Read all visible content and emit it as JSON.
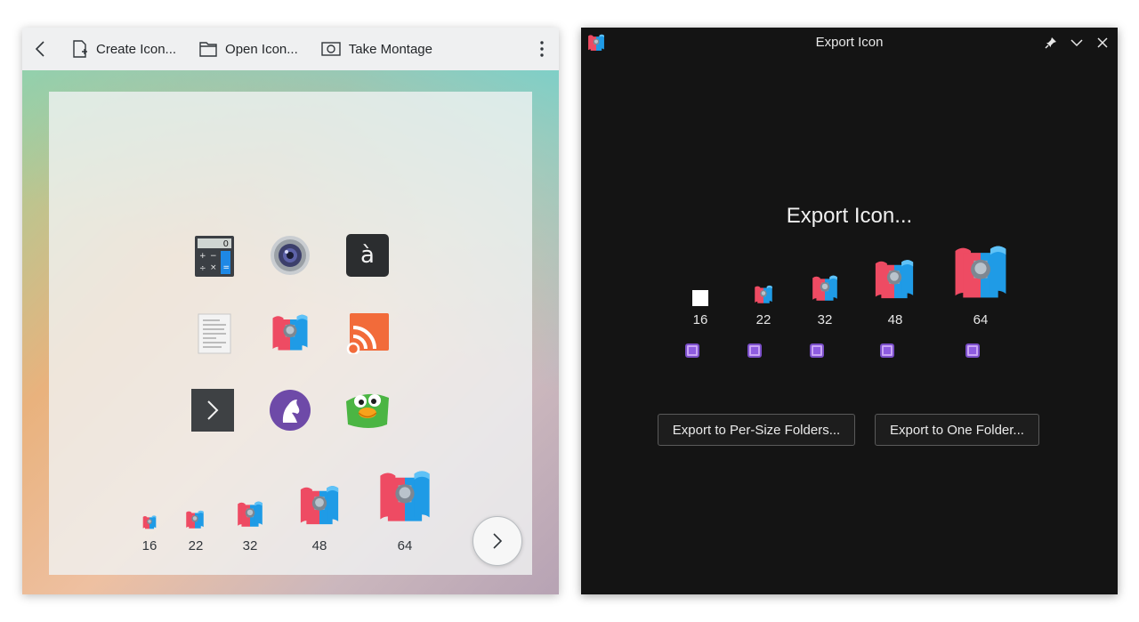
{
  "left_window": {
    "toolbar": {
      "back_icon": "chevron-left-icon",
      "create_icon": "Create Icon...",
      "open_icon": "Open Icon...",
      "take_montage": "Take Montage",
      "more_icon": "kebab-menu-icon"
    },
    "icon_grid": [
      [
        "calculator-icon",
        "webcam-icon",
        "accent-character-icon"
      ],
      [
        "text-document-icon",
        "scroll-icon",
        "rss-feed-icon"
      ],
      [
        "terminal-icon",
        "horse-knight-icon",
        "bird-icon"
      ]
    ],
    "accent_glyph": "à",
    "calculator_display": "0",
    "size_labels": [
      "16",
      "22",
      "32",
      "48",
      "64"
    ],
    "next_icon": "chevron-right-icon"
  },
  "right_window": {
    "title": "Export Icon",
    "heading": "Export Icon...",
    "sizes": [
      "16",
      "22",
      "32",
      "48",
      "64"
    ],
    "export_per_size": "Export to Per-Size Folders...",
    "export_one_folder": "Export to One Folder...",
    "controls": [
      "pin-icon",
      "minimize-icon",
      "close-icon"
    ]
  },
  "colors": {
    "scroll_red": "#ee4b63",
    "scroll_blue": "#1f9be6",
    "dark_bg": "#141414",
    "checkbox_purple": "#c9a5f5"
  }
}
